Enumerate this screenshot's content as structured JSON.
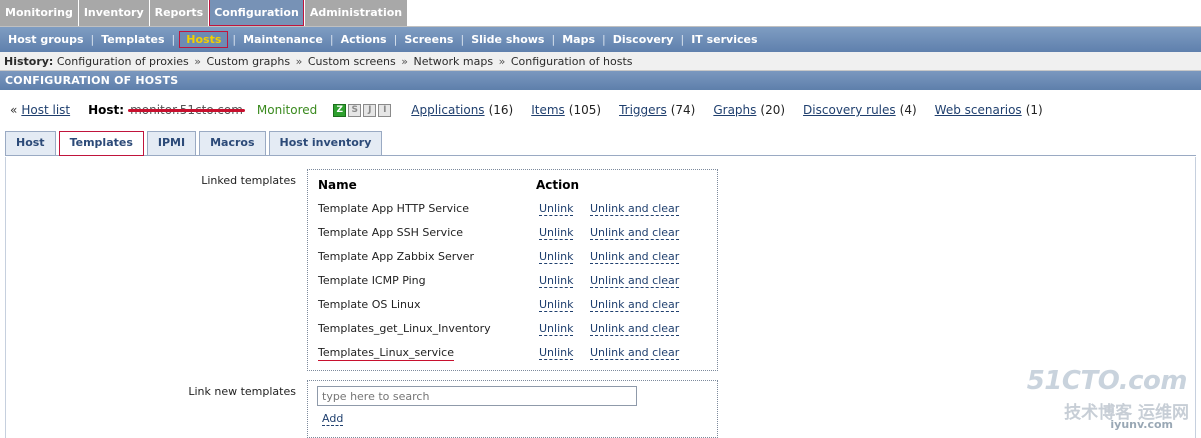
{
  "topmenu": {
    "items": [
      {
        "label": "Monitoring"
      },
      {
        "label": "Inventory"
      },
      {
        "label": "Reports"
      },
      {
        "label": "Configuration",
        "active": true
      },
      {
        "label": "Administration"
      }
    ]
  },
  "submenu": {
    "items": [
      {
        "label": "Host groups"
      },
      {
        "label": "Templates"
      },
      {
        "label": "Hosts",
        "active": true
      },
      {
        "label": "Maintenance"
      },
      {
        "label": "Actions"
      },
      {
        "label": "Screens"
      },
      {
        "label": "Slide shows"
      },
      {
        "label": "Maps"
      },
      {
        "label": "Discovery"
      },
      {
        "label": "IT services"
      }
    ]
  },
  "history": {
    "label": "History:",
    "items": [
      "Configuration of proxies",
      "Custom graphs",
      "Custom screens",
      "Network maps",
      "Configuration of hosts"
    ]
  },
  "page_title": "CONFIGURATION OF HOSTS",
  "host_header": {
    "back_arrow": "«",
    "host_list": "Host list",
    "host_label": "Host:",
    "host_name": "monitor.51cto.com",
    "status": "Monitored",
    "status_icons": [
      "Z",
      "S",
      "J",
      "I"
    ],
    "applications": {
      "label": "Applications",
      "count": "(16)"
    },
    "items": {
      "label": "Items",
      "count": "(105)"
    },
    "triggers": {
      "label": "Triggers",
      "count": "(74)"
    },
    "graphs": {
      "label": "Graphs",
      "count": "(20)"
    },
    "discovery": {
      "label": "Discovery rules",
      "count": "(4)"
    },
    "web": {
      "label": "Web scenarios",
      "count": "(1)"
    }
  },
  "tabs": [
    {
      "label": "Host"
    },
    {
      "label": "Templates",
      "active": true
    },
    {
      "label": "IPMI"
    },
    {
      "label": "Macros"
    },
    {
      "label": "Host inventory"
    }
  ],
  "linked_templates": {
    "label": "Linked templates",
    "col_name": "Name",
    "col_action": "Action",
    "unlink_label": "Unlink",
    "unlink_clear_label": "Unlink and clear",
    "rows": [
      {
        "name": "Template App HTTP Service"
      },
      {
        "name": "Template App SSH Service"
      },
      {
        "name": "Template App Zabbix Server"
      },
      {
        "name": "Template ICMP Ping"
      },
      {
        "name": "Template OS Linux"
      },
      {
        "name": "Templates_get_Linux_Inventory"
      },
      {
        "name": "Templates_Linux_service"
      }
    ]
  },
  "link_new": {
    "label": "Link new templates",
    "placeholder": "type here to search",
    "add_label": "Add"
  },
  "watermark": {
    "logo": "51CTO.com",
    "sub": "技术博客 运维网",
    "url": "iyunv.com"
  }
}
